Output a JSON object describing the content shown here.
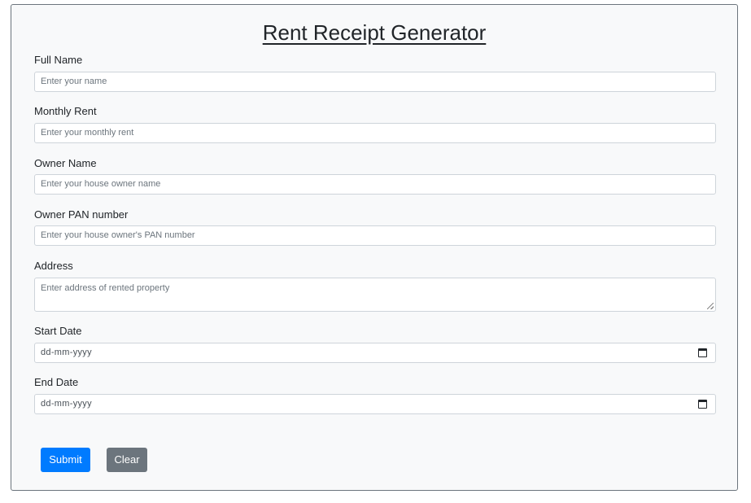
{
  "page": {
    "title": "Rent Receipt Generator"
  },
  "form": {
    "full_name": {
      "label": "Full Name",
      "placeholder": "Enter your name"
    },
    "monthly_rent": {
      "label": "Monthly Rent",
      "placeholder": "Enter your monthly rent"
    },
    "owner_name": {
      "label": "Owner Name",
      "placeholder": "Enter your house owner name"
    },
    "owner_pan": {
      "label": "Owner PAN number",
      "placeholder": "Enter your house owner's PAN number"
    },
    "address": {
      "label": "Address",
      "placeholder": "Enter address of rented property"
    },
    "start_date": {
      "label": "Start Date",
      "placeholder": "dd-mm-yyyy"
    },
    "end_date": {
      "label": "End Date",
      "placeholder": "dd-mm-yyyy"
    }
  },
  "buttons": {
    "submit": "Submit",
    "clear": "Clear"
  },
  "colors": {
    "primary": "#007bff",
    "secondary": "#6c757d",
    "background": "#f8f9fa"
  },
  "icons": {
    "date": "calendar-icon"
  }
}
